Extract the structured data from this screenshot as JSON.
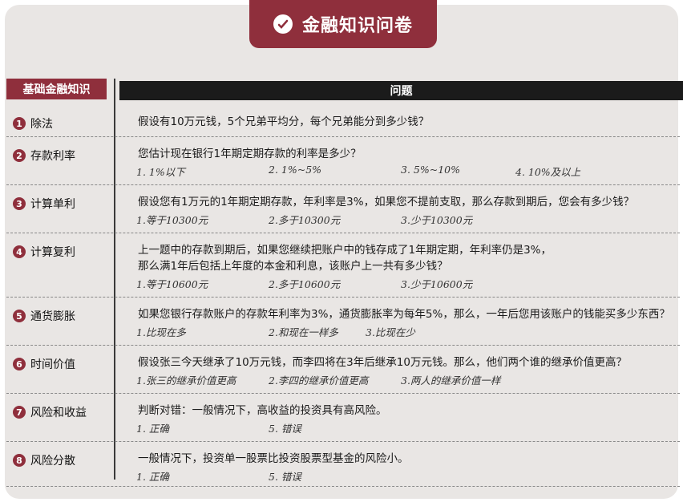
{
  "title": "金融知识问卷",
  "header": {
    "left": "基础金融知识",
    "right": "问题"
  },
  "rows": [
    {
      "num": "1",
      "topic": "除法",
      "question_lines": [
        "假设有10万元钱，5个兄弟平均分，每个兄弟能分到多少钱？"
      ],
      "options": []
    },
    {
      "num": "2",
      "topic": "存款利率",
      "question_lines": [
        "您估计现在银行1年期定期存款的利率是多少？"
      ],
      "options": [
        "1. 1%以下",
        "2. 1%~5%",
        "3. 5%~10%",
        "4. 10%及以上"
      ]
    },
    {
      "num": "3",
      "topic": "计算单利",
      "question_lines": [
        "假设您有1万元的1年期定期存款，年利率是3%，如果您不提前支取，那么存款到期后，您会有多少钱？"
      ],
      "options": [
        "1.等于10300元",
        "2.多于10300元",
        "3.少于10300元"
      ]
    },
    {
      "num": "4",
      "topic": "计算复利",
      "question_lines": [
        "上一题中的存款到期后，如果您继续把账户中的钱存成了1年期定期，年利率仍是3%，",
        "那么满1年后包括上年度的本金和利息，该账户上一共有多少钱？"
      ],
      "options": [
        "1.等于10600元",
        "2.多于10600元",
        "3.少于10600元"
      ]
    },
    {
      "num": "5",
      "topic": "通货膨胀",
      "question_lines": [
        "如果您银行存款账户的存款年利率为3%，通货膨胀率为每年5%，那么，一年后您用该账户的钱能买多少东西？"
      ],
      "options": [
        "1.比现在多",
        "2.和现在一样多",
        "3.比现在少"
      ]
    },
    {
      "num": "6",
      "topic": "时间价值",
      "question_lines": [
        "假设张三今天继承了10万元钱，而李四将在3年后继承10万元钱。那么，他们两个谁的继承价值更高？"
      ],
      "options": [
        "1.张三的继承价值更高",
        "2.李四的继承价值更高",
        "3.两人的继承价值一样"
      ]
    },
    {
      "num": "7",
      "topic": "风险和收益",
      "question_lines": [
        "判断对错：一般情况下，高收益的投资具有高风险。"
      ],
      "options": [
        "1. 正确",
        "5. 错误"
      ]
    },
    {
      "num": "8",
      "topic": "风险分散",
      "question_lines": [
        "一般情况下，投资单一股票比投资股票型基金的风险小。"
      ],
      "options": [
        "1. 正确",
        "5. 错误"
      ]
    }
  ]
}
